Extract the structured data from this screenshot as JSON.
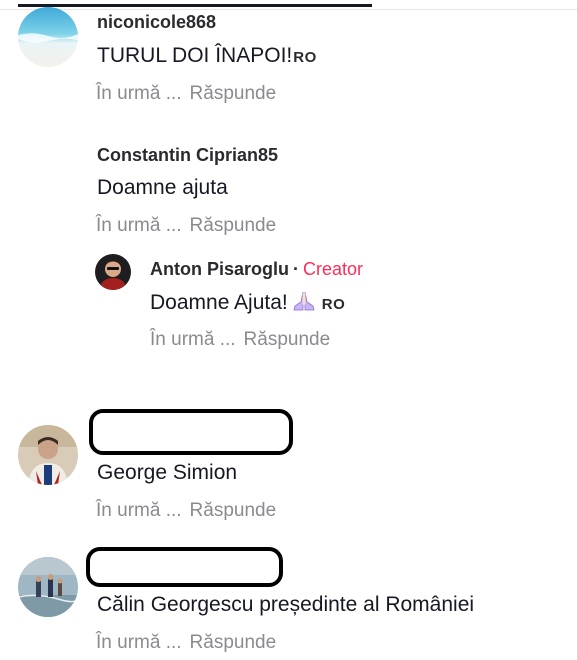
{
  "ui": {
    "time_label": "În urmă ...",
    "reply_label": "Răspunde",
    "creator_label": "Creator",
    "dot": "·",
    "lang_tag": "RO"
  },
  "comments": [
    {
      "username": "niconicole868",
      "text": "TURUL DOI ÎNAPOI!",
      "has_lang_tag": true
    },
    {
      "username": "Constantin Ciprian85",
      "text": "Doamne ajuta",
      "has_lang_tag": false,
      "replies": [
        {
          "username": "Anton Pisaroglu",
          "is_creator": true,
          "text": "Doamne Ajuta!",
          "emoji": "praying-hands",
          "has_lang_tag": true
        }
      ]
    },
    {
      "username": "",
      "username_redacted": true,
      "text": "George Simion",
      "has_lang_tag": false
    },
    {
      "username": "",
      "username_redacted": true,
      "text": "Călin Georgescu președinte al României",
      "has_lang_tag": false
    }
  ],
  "colors": {
    "creator": "#fe2c55",
    "meta": "#8a8b91",
    "text": "#161823"
  }
}
